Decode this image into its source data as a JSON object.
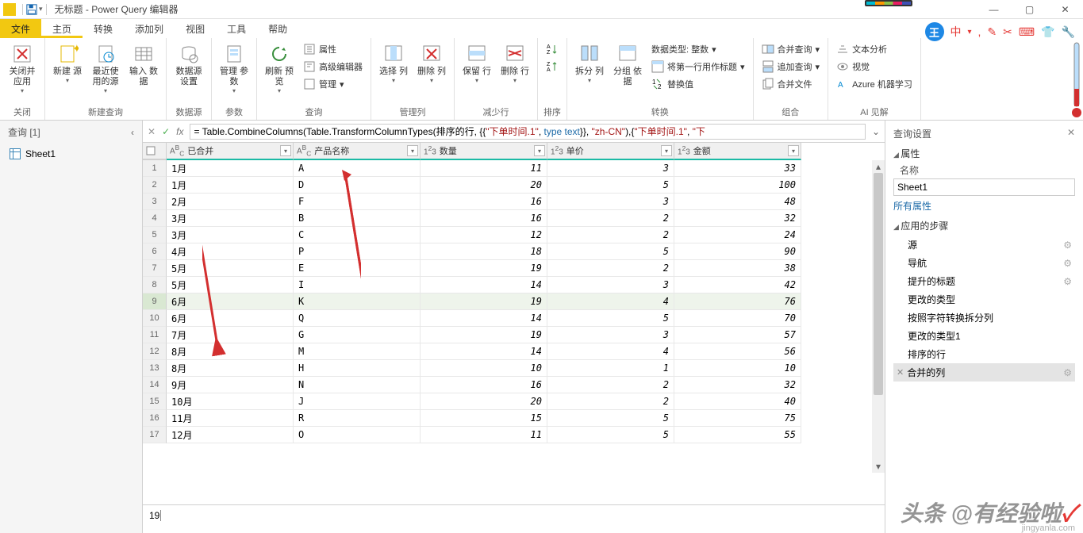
{
  "app": {
    "title": "无标题 - Power Query 编辑器",
    "dropdown_indicator": "▾"
  },
  "window": {
    "min": "—",
    "max": "▢",
    "close": "✕"
  },
  "tabs": {
    "file": "文件",
    "items": [
      "主页",
      "转换",
      "添加列",
      "视图",
      "工具",
      "帮助"
    ],
    "active_index": 0
  },
  "ribbon": {
    "close_group": {
      "close_apply": "关闭并\n应用",
      "label": "关闭"
    },
    "new_query_group": {
      "new_source": "新建\n源",
      "recent_source": "最近使\n用的源",
      "enter_data": "输入\n数据",
      "label": "新建查询"
    },
    "datasource_group": {
      "ds_settings": "数据源\n设置",
      "label": "数据源"
    },
    "params_group": {
      "manage_params": "管理\n参数",
      "label": "参数"
    },
    "query_group": {
      "refresh": "刷新\n预览",
      "props": "属性",
      "adv_editor": "高级编辑器",
      "manage": "管理",
      "label": "查询"
    },
    "columns_group": {
      "choose_cols": "选择\n列",
      "remove_cols": "删除\n列",
      "label": "管理列"
    },
    "rows_group": {
      "keep_rows": "保留\n行",
      "remove_rows": "删除\n行",
      "label": "减少行"
    },
    "sort_group": {
      "label": "排序"
    },
    "transform_group": {
      "split_col": "拆分\n列",
      "group_by": "分组\n依据",
      "dtype": "数据类型: 整数",
      "first_row": "将第一行用作标题",
      "replace": "替换值",
      "label": "转换"
    },
    "combine_group": {
      "merge": "合并查询",
      "append": "追加查询",
      "combine_files": "合并文件",
      "label": "组合"
    },
    "ai_group": {
      "text_analytics": "文本分析",
      "vision": "视觉",
      "azure_ml": "Azure 机器学习",
      "label": "AI 见解"
    }
  },
  "left_pane": {
    "header": "查询 [1]",
    "queries": [
      "Sheet1"
    ]
  },
  "formula": {
    "text_prefix": "= Table.CombineColumns(Table.TransformColumnTypes(排序的行, {{",
    "str1": "\"下单时间.1\"",
    "sep1": ", ",
    "type_kw": "type text",
    "sep2": "}}, ",
    "str2": "\"zh-CN\"",
    "sep3": "),{",
    "str3": "\"下单时间.1\"",
    "sep4": ", ",
    "str4": "\"下"
  },
  "grid": {
    "columns": [
      {
        "type": "ABC",
        "name": "已合并"
      },
      {
        "type": "ABC",
        "name": "产品名称"
      },
      {
        "type": "123",
        "name": "数量"
      },
      {
        "type": "123",
        "name": "单价"
      },
      {
        "type": "123",
        "name": "金额"
      }
    ],
    "filler_cols": 1,
    "rows": [
      {
        "n": 1,
        "c": [
          "1月",
          "A",
          "11",
          "3",
          "33"
        ]
      },
      {
        "n": 2,
        "c": [
          "1月",
          "D",
          "20",
          "5",
          "100"
        ]
      },
      {
        "n": 3,
        "c": [
          "2月",
          "F",
          "16",
          "3",
          "48"
        ]
      },
      {
        "n": 4,
        "c": [
          "3月",
          "B",
          "16",
          "2",
          "32"
        ]
      },
      {
        "n": 5,
        "c": [
          "3月",
          "C",
          "12",
          "2",
          "24"
        ]
      },
      {
        "n": 6,
        "c": [
          "4月",
          "P",
          "18",
          "5",
          "90"
        ]
      },
      {
        "n": 7,
        "c": [
          "5月",
          "E",
          "19",
          "2",
          "38"
        ]
      },
      {
        "n": 8,
        "c": [
          "5月",
          "I",
          "14",
          "3",
          "42"
        ]
      },
      {
        "n": 9,
        "c": [
          "6月",
          "K",
          "19",
          "4",
          "76"
        ],
        "sel": true
      },
      {
        "n": 10,
        "c": [
          "6月",
          "Q",
          "14",
          "5",
          "70"
        ]
      },
      {
        "n": 11,
        "c": [
          "7月",
          "G",
          "19",
          "3",
          "57"
        ]
      },
      {
        "n": 12,
        "c": [
          "8月",
          "M",
          "14",
          "4",
          "56"
        ]
      },
      {
        "n": 13,
        "c": [
          "8月",
          "H",
          "10",
          "1",
          "10"
        ]
      },
      {
        "n": 14,
        "c": [
          "9月",
          "N",
          "16",
          "2",
          "32"
        ]
      },
      {
        "n": 15,
        "c": [
          "10月",
          "J",
          "20",
          "2",
          "40"
        ]
      },
      {
        "n": 16,
        "c": [
          "11月",
          "R",
          "15",
          "5",
          "75"
        ]
      },
      {
        "n": 17,
        "c": [
          "12月",
          "O",
          "11",
          "5",
          "55"
        ]
      }
    ]
  },
  "detail": "19",
  "right_pane": {
    "title": "查询设置",
    "props_section": "属性",
    "name_label": "名称",
    "name_value": "Sheet1",
    "all_props": "所有属性",
    "steps_section": "应用的步骤",
    "steps": [
      {
        "name": "源",
        "gear": true
      },
      {
        "name": "导航",
        "gear": true
      },
      {
        "name": "提升的标题",
        "gear": true
      },
      {
        "name": "更改的类型"
      },
      {
        "name": "按照字符转换拆分列"
      },
      {
        "name": "更改的类型1"
      },
      {
        "name": "排序的行"
      },
      {
        "name": "合并的列",
        "gear": true,
        "sel": true,
        "x": true
      }
    ]
  },
  "watermark": {
    "main": "头条 @有经验啦",
    "check": "✓",
    "small": "jingyanla.com"
  },
  "badge": "王",
  "ime": "中"
}
